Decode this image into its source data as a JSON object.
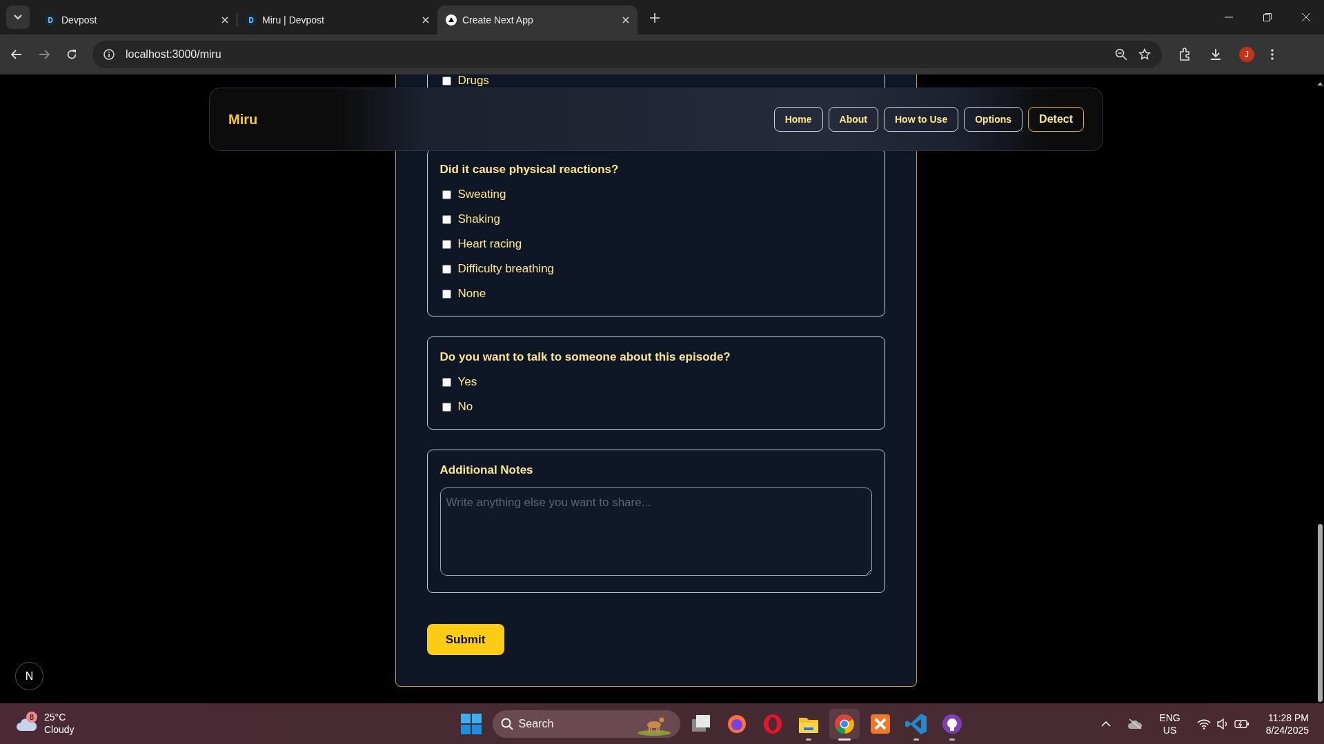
{
  "browser": {
    "tabs": [
      {
        "title": "Devpost",
        "favicon": "D",
        "selected": false
      },
      {
        "title": "Miru | Devpost",
        "favicon": "D",
        "selected": false
      },
      {
        "title": "Create Next App",
        "selected": true
      }
    ],
    "url": "localhost:3000/miru",
    "avatar": "J"
  },
  "navbar": {
    "brand": "Miru",
    "links": [
      {
        "label": "Home",
        "kind": "plain"
      },
      {
        "label": "About",
        "kind": "plain"
      },
      {
        "label": "How to Use",
        "kind": "plain"
      },
      {
        "label": "Options",
        "kind": "plain"
      },
      {
        "label": "Detect",
        "kind": "accent"
      }
    ]
  },
  "form": {
    "partial_options": [
      {
        "label": "Drugs",
        "checked": false
      }
    ],
    "questions": [
      {
        "title": "Did it cause physical reactions?",
        "options": [
          {
            "label": "Sweating",
            "checked": false
          },
          {
            "label": "Shaking",
            "checked": false
          },
          {
            "label": "Heart racing",
            "checked": false
          },
          {
            "label": "Difficulty breathing",
            "checked": false
          },
          {
            "label": "None",
            "checked": false
          }
        ]
      },
      {
        "title": "Do you want to talk to someone about this episode?",
        "options": [
          {
            "label": "Yes",
            "checked": false
          },
          {
            "label": "No",
            "checked": false
          }
        ]
      }
    ],
    "notes": {
      "title": "Additional Notes",
      "placeholder": "Write anything else you want to share..."
    },
    "submit": "Submit"
  },
  "dev_indicator": "N",
  "taskbar": {
    "weather": {
      "badge": "8",
      "temperature": "25°C",
      "condition": "Cloudy"
    },
    "search": {
      "placeholder": "Search"
    },
    "apps": [
      {
        "kind": "taskview",
        "running": false,
        "selected": false
      },
      {
        "kind": "firefox",
        "running": false,
        "selected": false
      },
      {
        "kind": "opera",
        "running": false,
        "selected": false
      },
      {
        "kind": "files",
        "running": true,
        "selected": false
      },
      {
        "kind": "chrome",
        "running": true,
        "selected": true
      },
      {
        "kind": "xampp",
        "running": false,
        "selected": false
      },
      {
        "kind": "vscode",
        "running": true,
        "selected": false
      },
      {
        "kind": "github",
        "running": true,
        "selected": false
      }
    ],
    "tray": {
      "language": "ENG",
      "region": "US",
      "time": "11:28 PM",
      "date": "8/24/2025"
    }
  }
}
